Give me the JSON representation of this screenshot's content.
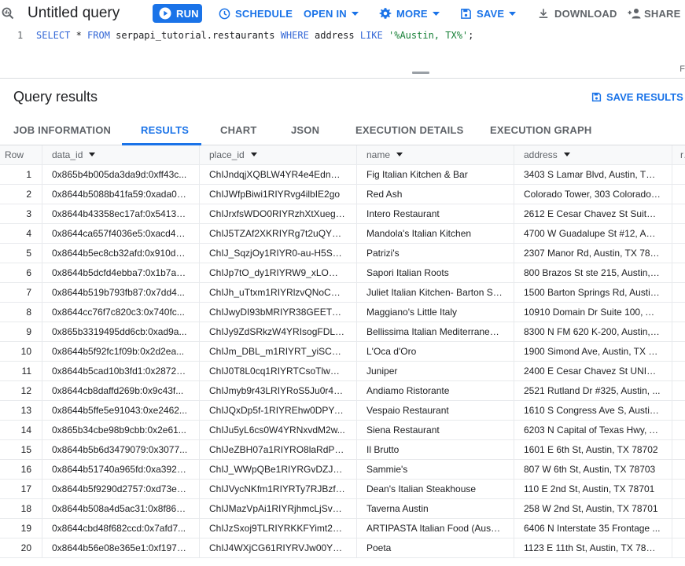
{
  "toolbar": {
    "title": "Untitled query",
    "run": "RUN",
    "schedule": "SCHEDULE",
    "open_in": "OPEN IN",
    "more": "MORE",
    "save": "SAVE",
    "download": "DOWNLOAD",
    "share": "SHARE"
  },
  "editor": {
    "line_number": "1",
    "kw_select": "SELECT",
    "star_from_pre": " * ",
    "kw_from": "FROM",
    "table": " serpapi_tutorial.restaurants ",
    "kw_where": "WHERE",
    "column": " address ",
    "kw_like": "LIKE",
    "string_literal": "'%Austin, TX%'",
    "terminator": ";",
    "edge_letter": "F"
  },
  "results": {
    "title": "Query results",
    "save_results": "SAVE RESULTS"
  },
  "tabs": [
    {
      "label": "JOB INFORMATION"
    },
    {
      "label": "RESULTS"
    },
    {
      "label": "CHART"
    },
    {
      "label": "JSON"
    },
    {
      "label": "EXECUTION DETAILS"
    },
    {
      "label": "EXECUTION GRAPH"
    }
  ],
  "table": {
    "headers": {
      "row": "Row",
      "data_id": "data_id",
      "place_id": "place_id",
      "name": "name",
      "address": "address",
      "extra": "ra"
    },
    "rows": [
      {
        "row": "1",
        "data_id": "0x865b4b005da3da9d:0xff43c...",
        "place_id": "ChIJndqjXQBLW4YR4e4Edn7J...",
        "name": "Fig Italian Kitchen & Bar",
        "address": "3403 S Lamar Blvd, Austin, TX ..."
      },
      {
        "row": "2",
        "data_id": "0x8644b5088b41fa59:0xada04...",
        "place_id": "ChIJWfpBiwi1RIYRvg4ilbIE2go",
        "name": "Red Ash",
        "address": "Colorado Tower, 303 Colorado ..."
      },
      {
        "row": "3",
        "data_id": "0x8644b43358ec17af:0x5413a...",
        "place_id": "ChIJrxfsWDO0RIYRzhXtXuegE...",
        "name": "Intero Restaurant",
        "address": "2612 E Cesar Chavez St Suite 1..."
      },
      {
        "row": "4",
        "data_id": "0x8644ca657f4036e5:0xacd42...",
        "place_id": "ChIJ5TZAf2XKRIYRg7t2uQYn1...",
        "name": "Mandola's Italian Kitchen",
        "address": "4700 W Guadalupe St #12, Aus..."
      },
      {
        "row": "5",
        "data_id": "0x8644b5ec8cb32afd:0x910d5...",
        "place_id": "ChIJ_SqzjOy1RIYR0-au-H5SDZE",
        "name": "Patrizi's",
        "address": "2307 Manor Rd, Austin, TX 787..."
      },
      {
        "row": "6",
        "data_id": "0x8644b5dcfd4ebba7:0x1b7ab...",
        "place_id": "ChIJp7tO_dy1RIYRW9_xLOG_e...",
        "name": "Sapori Italian Roots",
        "address": "800 Brazos St ste 215, Austin, ..."
      },
      {
        "row": "7",
        "data_id": "0x8644b519b793fb87:0x7dd4...",
        "place_id": "ChIJh_uTtxm1RIYRlzvQNoCD1...",
        "name": "Juliet Italian Kitchen- Barton Sp...",
        "address": "1500 Barton Springs Rd, Austin..."
      },
      {
        "row": "8",
        "data_id": "0x8644cc76f7c820c3:0x740fc...",
        "place_id": "ChIJwyDI93bMRIYR38GEET3D...",
        "name": "Maggiano's Little Italy",
        "address": "10910 Domain Dr Suite 100, Au..."
      },
      {
        "row": "9",
        "data_id": "0x865b3319495dd6cb:0xad9a...",
        "place_id": "ChIJy9ZdSRkzW4YRIsogFDLN...",
        "name": "Bellissima Italian Mediterranea...",
        "address": "8300 N FM 620 K-200, Austin, ..."
      },
      {
        "row": "10",
        "data_id": "0x8644b5f92fc1f09b:0x2d2ea...",
        "place_id": "ChIJm_DBL_m1RIYRT_yiSCvq0gI",
        "name": "L'Oca d'Oro",
        "address": "1900 Simond Ave, Austin, TX 7..."
      },
      {
        "row": "11",
        "data_id": "0x8644b5cad10b3fd1:0x28721...",
        "place_id": "ChIJ0T8L0cq1RIYRTCsoTlwUcig",
        "name": "Juniper",
        "address": "2400 E Cesar Chavez St UNIT 3..."
      },
      {
        "row": "12",
        "data_id": "0x8644cb8daffd269b:0x9c43f...",
        "place_id": "ChIJmyb9r43LRIYRoS5Ju0r4Q...",
        "name": "Andiamo Ristorante",
        "address": "2521 Rutland Dr #325, Austin, ..."
      },
      {
        "row": "13",
        "data_id": "0x8644b5ffe5e91043:0xe2462...",
        "place_id": "ChIJQxDp5f-1RIYREhw0DPYuRuI",
        "name": "Vespaio Restaurant",
        "address": "1610 S Congress Ave S, Austin,..."
      },
      {
        "row": "14",
        "data_id": "0x865b34cbe98b9cbb:0x2e61...",
        "place_id": "ChIJu5yL6cs0W4YRNxvdM2w...",
        "name": "Siena Restaurant",
        "address": "6203 N Capital of Texas Hwy, A..."
      },
      {
        "row": "15",
        "data_id": "0x8644b5b6d3479079:0x3077...",
        "place_id": "ChIJeZBH07a1RIYRO8laRdPdd...",
        "name": "Il Brutto",
        "address": "1601 E 6th St, Austin, TX 78702"
      },
      {
        "row": "16",
        "data_id": "0x8644b51740a965fd:0xa3926...",
        "place_id": "ChIJ_WWpQBe1RIYRGvDZJ7tg...",
        "name": "Sammie's",
        "address": "807 W 6th St, Austin, TX 78703"
      },
      {
        "row": "17",
        "data_id": "0x8644b5f9290d2757:0xd73ed...",
        "place_id": "ChIJVycNKfm1RIYRTy7RJBzfPtc",
        "name": "Dean's Italian Steakhouse",
        "address": "110 E 2nd St, Austin, TX 78701"
      },
      {
        "row": "18",
        "data_id": "0x8644b508a4d5ac31:0x8f86a...",
        "place_id": "ChIJMazVpAi1RIYRjhmcLjSvho8",
        "name": "Taverna Austin",
        "address": "258 W 2nd St, Austin, TX 78701"
      },
      {
        "row": "19",
        "data_id": "0x8644cbd48f682ccd:0x7afd7...",
        "place_id": "ChIJzSxoj9TLRIYRKKFYimt2_Xo",
        "name": "ARTIPASTA Italian Food (Austi...",
        "address": "6406 N Interstate 35 Frontage ..."
      },
      {
        "row": "20",
        "data_id": "0x8644b56e08e365e1:0xf1970...",
        "place_id": "ChIJ4WXjCG61RIYRVJw00YsKl...",
        "name": "Poeta",
        "address": "1123 E 11th St, Austin, TX 78702"
      }
    ]
  },
  "colors": {
    "accent": "#1a73e8",
    "text": "#202124",
    "muted": "#5f6368",
    "border": "#dadce0"
  }
}
